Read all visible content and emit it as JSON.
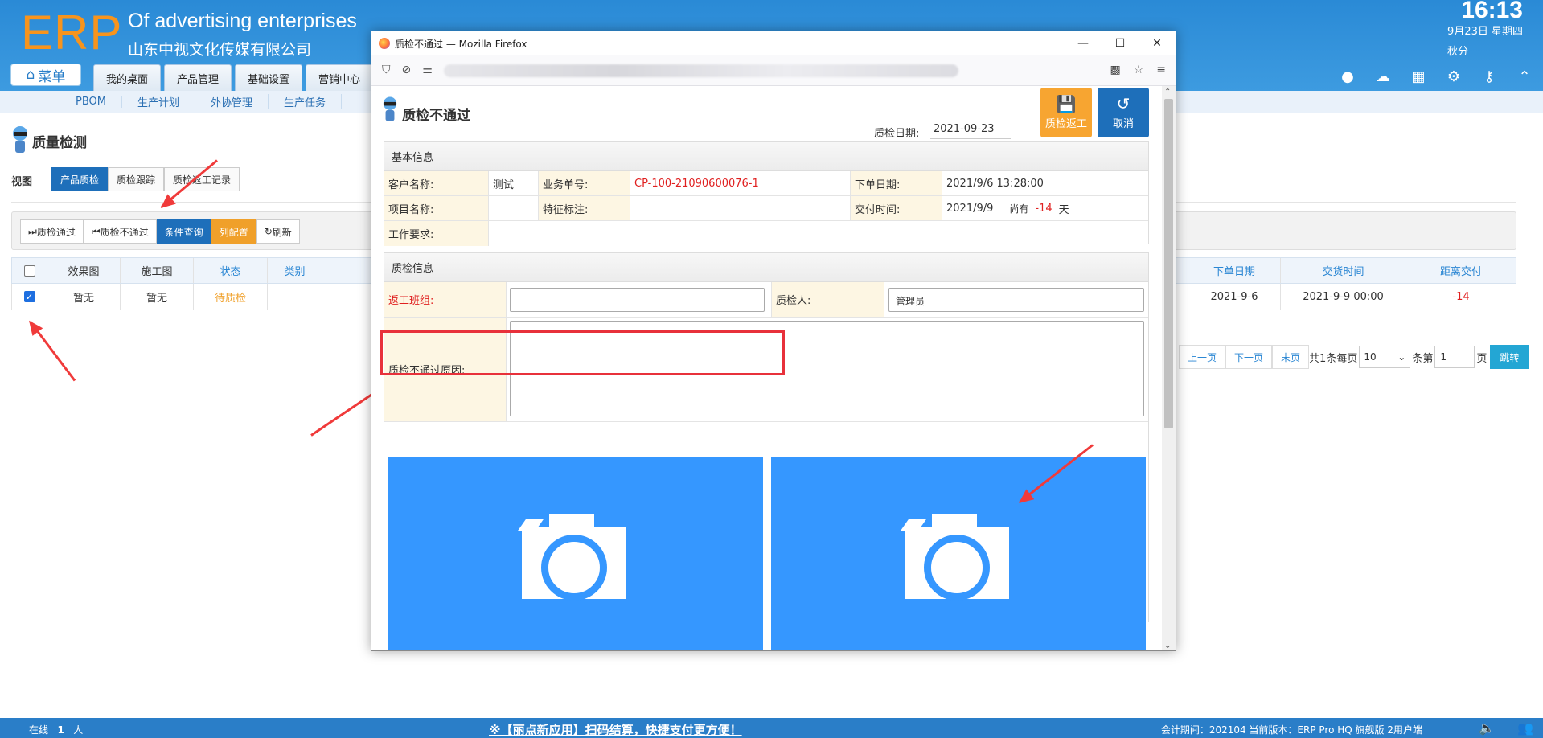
{
  "header": {
    "logo": "ERP",
    "company_en": "Of advertising enterprises",
    "company_cn": "山东中视文化传媒有限公司",
    "time": "16:13",
    "date": "9月23日 星期四",
    "user": "秋分",
    "menu_label": "菜单",
    "nav_tabs": [
      "我的桌面",
      "产品管理",
      "基础设置",
      "营销中心"
    ],
    "tool_icons": [
      "chat-icon",
      "cloud-upload-icon",
      "apps-icon",
      "gear-icon",
      "key-icon",
      "collapse-icon"
    ]
  },
  "subnav": [
    "PBOM",
    "生产计划",
    "外协管理",
    "生产任务"
  ],
  "page": {
    "title": "质量检测",
    "view_label": "视图",
    "view_tabs": [
      "产品质检",
      "质检跟踪",
      "质检返工记录"
    ],
    "toolbar": {
      "pass": "质检通过",
      "fail": "质检不通过",
      "query": "条件查询",
      "columns": "列配置",
      "refresh": "刷新"
    },
    "grid": {
      "headers": {
        "effect": "效果图",
        "construction": "施工图",
        "status": "状态",
        "category": "类别",
        "order_date": "下单日期",
        "delivery_time": "交货时间",
        "days_left": "距离交付"
      },
      "row": {
        "effect": "暂无",
        "construction": "暂无",
        "status": "待质检",
        "category": "",
        "order_date": "2021-9-6",
        "delivery_time": "2021-9-9 00:00",
        "days_left": "-14"
      }
    },
    "pager": {
      "prev": "上一页",
      "next": "下一页",
      "last": "末页",
      "total_text": "共1条每页",
      "page_size": "10",
      "tiao_di": "条第",
      "page_no": "1",
      "ye": "页",
      "go": "跳转"
    }
  },
  "footer": {
    "online_label": "在线",
    "online_count": "1",
    "online_unit": "人",
    "promo": "※【丽点新应用】扫码结算，快捷支付更方便！",
    "version": "会计期间：202104 当前版本：ERP Pro HQ 旗舰版 2用户端"
  },
  "firefox": {
    "window_title": "质检不通过 — Mozilla Firefox",
    "controls": [
      "—",
      "☐",
      "✕"
    ]
  },
  "dialog": {
    "title": "质检不通过",
    "qc_date_label": "质检日期:",
    "qc_date": "2021-09-23",
    "rework_button": "质检返工",
    "cancel_button": "取消",
    "basic_info": {
      "title": "基本信息",
      "customer_label": "客户名称:",
      "customer": "测试",
      "order_no_label": "业务单号:",
      "order_no": "CP-100-21090600076-1",
      "order_date_label": "下单日期:",
      "order_date": "2021/9/6 13:28:00",
      "project_label": "项目名称:",
      "project": "",
      "feature_label": "特征标注:",
      "feature": "",
      "delivery_label": "交付时间:",
      "delivery_date": "2021/9/9",
      "remaining_prefix": "尚有",
      "remaining_days": "-14",
      "remaining_unit": "天",
      "requirement_label": "工作要求:",
      "requirement": ""
    },
    "qc_info": {
      "title": "质检信息",
      "rework_team_label": "返工班组:",
      "rework_team_value": "",
      "inspector_label": "质检人:",
      "inspector": "管理员",
      "reason_label": "质检不通过原因:",
      "reason": ""
    },
    "photos": [
      "camera-icon",
      "camera-icon"
    ]
  },
  "colors": {
    "header_blue": "#2a8ad6",
    "logo_orange": "#f7941d",
    "primary_blue": "#1e6fba",
    "orange": "#f7a531",
    "photo_blue": "#3597ff",
    "highlight_red": "#e8313b"
  }
}
